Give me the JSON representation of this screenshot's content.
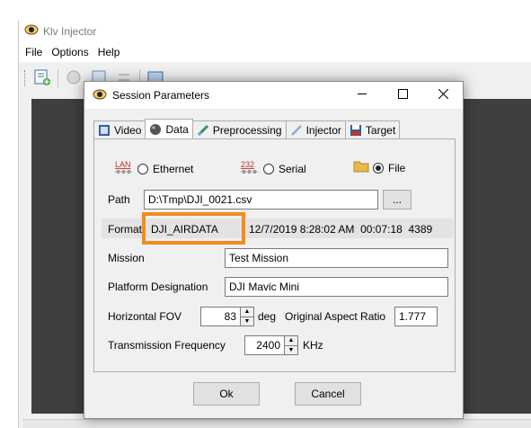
{
  "main_window": {
    "title": "Klv Injector",
    "menu": [
      "File",
      "Options",
      "Help"
    ]
  },
  "dialog": {
    "title": "Session Parameters",
    "controls": {
      "minimize": "—",
      "maximize": "☐",
      "close": "✕"
    },
    "tabs": [
      {
        "label": "Video",
        "icon": "film-icon"
      },
      {
        "label": "Data",
        "icon": "database-icon"
      },
      {
        "label": "Preprocessing",
        "icon": "brush-icon"
      },
      {
        "label": "Injector",
        "icon": "pen-icon"
      },
      {
        "label": "Target",
        "icon": "floppy-icon"
      }
    ],
    "active_tab": "Data",
    "source": {
      "ethernet": {
        "label": "Ethernet",
        "icon_text": "LAN",
        "selected": false
      },
      "serial": {
        "label": "Serial",
        "icon_text": "232",
        "selected": false
      },
      "file": {
        "label": "File",
        "icon": "folder-icon",
        "selected": true
      }
    },
    "path": {
      "label": "Path",
      "value": "D:\\Tmp\\DJI_0021.csv",
      "browse": "..."
    },
    "format": {
      "label": "Format",
      "value": "DJI_AIRDATA",
      "info": "12/7/2019 8:28:02 AM  00:07:18  4389"
    },
    "mission": {
      "label": "Mission",
      "value": "Test Mission"
    },
    "platform": {
      "label": "Platform Designation",
      "value": "DJI Mavic Mini"
    },
    "fov": {
      "label": "Horizontal FOV",
      "value": "83",
      "unit": "deg"
    },
    "aspect": {
      "label": "Original Aspect Ratio",
      "value": "1.777"
    },
    "frequency": {
      "label": "Transmission Frequency",
      "value": "2400",
      "unit": "KHz"
    },
    "ok_label": "Ok",
    "cancel_label": "Cancel"
  },
  "colors": {
    "highlight": "#f28c1c",
    "dark_area": "#3f3f3f"
  }
}
